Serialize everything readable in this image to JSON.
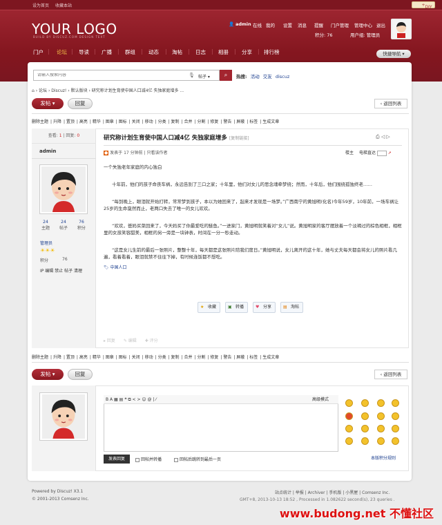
{
  "topbar": {
    "links": [
      "设为首页",
      "收藏本站"
    ],
    "diy": "DIY"
  },
  "header": {
    "logo": "YOUR LOGO",
    "logo_sub": "BUILD BY DISCUZ.COM DESIGN TEXT",
    "user": "admin",
    "status": "在线",
    "user_links": [
      "我的",
      "设置",
      "消息",
      "提醒",
      "门户管理",
      "管理中心",
      "退出"
    ],
    "credit_label": "积分: 76",
    "group_label": "用户组: 管理员"
  },
  "nav": [
    "门户",
    "论坛",
    "导读",
    "广播",
    "群组",
    "动态",
    "淘帖",
    "日志",
    "相册",
    "分享",
    "排行榜"
  ],
  "quicknav": "快捷导航",
  "search": {
    "placeholder": "请输入搜索内容",
    "option": "帖子",
    "hot_label": "热搜:",
    "hot": [
      "活动",
      "交友",
      "discuz"
    ]
  },
  "breadcrumb": [
    "论坛",
    "Discuz!",
    "默认版块",
    "研究称计划生育使中国人口减4亿 失独家庭增多 ..."
  ],
  "buttons": {
    "post": "发帖",
    "reply": "回复",
    "back": "返回列表"
  },
  "modbar": [
    "删除主题",
    "升降",
    "置顶",
    "高亮",
    "精华",
    "图章",
    "图标",
    "关闭",
    "移动",
    "分类",
    "复制",
    "合并",
    "分割",
    "修复",
    "警告",
    "屏蔽",
    "标签",
    "生成文章"
  ],
  "thread": {
    "views_label": "查看:",
    "views": "1",
    "replies_label": "回复:",
    "replies": "0",
    "title": "研究称计划生育使中国人口减4亿 失独家庭增多",
    "copy_link": "[复制链接]",
    "author": "admin",
    "posted": "发表于 17 分钟前",
    "only_author": "只看该作者",
    "floor": "楼主",
    "mode": "电梯直达",
    "stats": [
      {
        "v": "24",
        "l": "主题"
      },
      {
        "v": "24",
        "l": "帖子"
      },
      {
        "v": "76",
        "l": "积分"
      }
    ],
    "group": "管理员",
    "credit_label": "积分",
    "credit": "76",
    "admin_links": "IP 编辑 禁止 帖子 清理",
    "paragraphs": [
      "一个失独老年家庭的内心独白",
      "十年前，他们的孩子命丧车祸，永远告别了三口之家；十年里，他们对女儿的思念魂牵梦绕；然而，十年后，他们围绕孤独终老……",
      "“每到晚上，眼泪就开始打转，常常梦到孩子，本以为她回来了，起来才发现是一场梦。”广西南宁的黄旭明(化名)今年59岁，10年前，一场车祸让25岁的生命戛然而止，老两口失去了唯一的女儿欢欢。",
      "“欢欢，爸妈买菜回来了，今天妈买了你最爱吃的鲢鱼。”一进家门，黄旭明就笑着对“女儿”说。黄旭明家的客厅摆放着一个淡褐过的棕色相框，相框里的女孩笑容甜美，相框的另一旁是一块钟表，时间在一分一秒走动。",
      "“这是女儿生前的最后一张照片，整整十年，每天都是这张照片陪我们度日。”黄旭明说，女儿离开的这十年，她与丈夫每天都会将女儿的照片看几遍，看着看着，眼泪就禁不住往下掉，有时候连饭都不想吃。"
    ],
    "tag": "中国人口",
    "actions": [
      "收藏",
      "转播",
      "分享",
      "淘帖"
    ],
    "footer_actions": [
      "回复",
      "编辑",
      "评分"
    ]
  },
  "editor": {
    "toolbar": "B  A  ▦  ▤  ❝  ⧉  < >  ☺  @  |  ⁄",
    "advanced": "高级模式",
    "submit": "发表回复",
    "check1": "回帖并转播",
    "check2": "回帖后跳转到最后一页",
    "rules": "本版积分规则"
  },
  "footer": {
    "powered": "Powered by Discuz! X3.1",
    "copyright": "© 2001-2013 Comsenz Inc.",
    "links": "站点统计 | 举报 | Archiver | 手机版 | 小黑屋 | Comsenz Inc.",
    "gmt": "GMT+8, 2013-10-13 18:52 , Processed in 1.082622 second(s), 23 queries ."
  },
  "watermark": "www.budong.net 不懂社区",
  "colors": {
    "brand": "#891820",
    "accent": "#a3252f"
  }
}
